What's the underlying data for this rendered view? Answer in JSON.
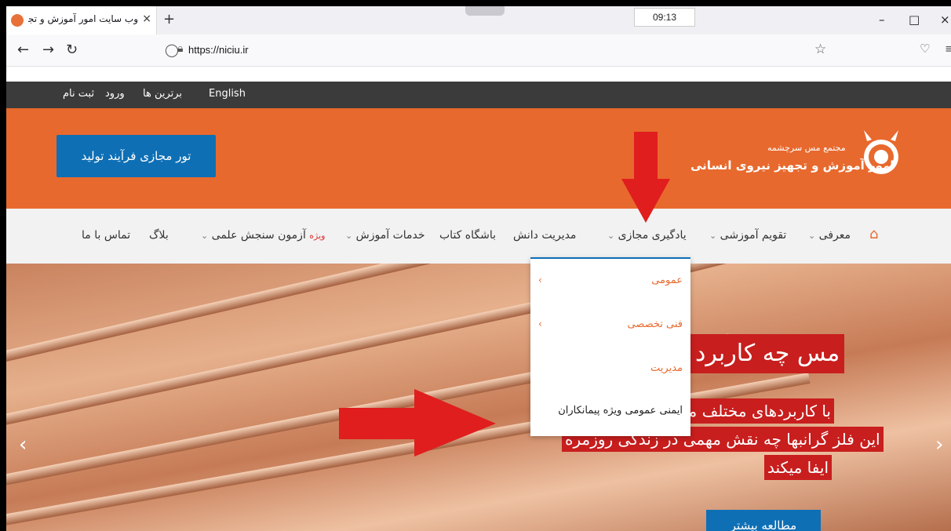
{
  "browser": {
    "tab_title": "وب سایت امور آموزش و تجهیز نی",
    "tab_close": "×",
    "new_tab": "+",
    "clock": "09:13",
    "url": "https://niciu.ir",
    "controls": {
      "minimize": "–",
      "maximize": "□",
      "close": "×"
    }
  },
  "topbar": {
    "english": "English",
    "top": "برترین ها",
    "login": "ورود",
    "signup": "ثبت نام"
  },
  "header": {
    "tour_button": "تور مجازی فرآیند تولید",
    "logo_sub": "مجتمع مس سرچشمه",
    "logo_main": "امور آموزش و تجهیز نیروی انسانی"
  },
  "nav": {
    "items": [
      {
        "label": "معرفی",
        "caret": "⌄"
      },
      {
        "label": "تقویم آموزشی",
        "caret": "⌄"
      },
      {
        "label": "یادگیری مجازی",
        "caret": "⌄"
      },
      {
        "label": "مدیریت دانش"
      },
      {
        "label": "باشگاه کتاب"
      },
      {
        "label": "خدمات آموزش",
        "caret": "⌄"
      },
      {
        "label": "آزمون سنجش علمی",
        "badge": "ویژه",
        "caret": "⌄"
      },
      {
        "label": "بلاگ"
      },
      {
        "label": "تماس با ما"
      }
    ]
  },
  "dropdown": {
    "items": [
      {
        "label": "عمومی",
        "chev": "‹",
        "color": "#e8692d"
      },
      {
        "label": "فنی تخصصی",
        "chev": "‹",
        "color": "#e8692d"
      },
      {
        "label": "مدیریت",
        "color": "#e8692d"
      },
      {
        "label": "ایمنی عمومی ویژه پیمانکاران",
        "color": "#222222"
      }
    ]
  },
  "hero": {
    "title": "مس چه کاربرد",
    "line1": "با کاربردهای مختلف مس",
    "line2": "این فلز گرانبها چه نقش مهمی در زندگی روزمره",
    "line3": "ایفا میکند",
    "more_button": "مطالعه بیشتر",
    "prev": "‹",
    "next": "›"
  },
  "colors": {
    "accent": "#e8692d",
    "blue": "#0e6fb5",
    "red": "#c81e1e"
  }
}
